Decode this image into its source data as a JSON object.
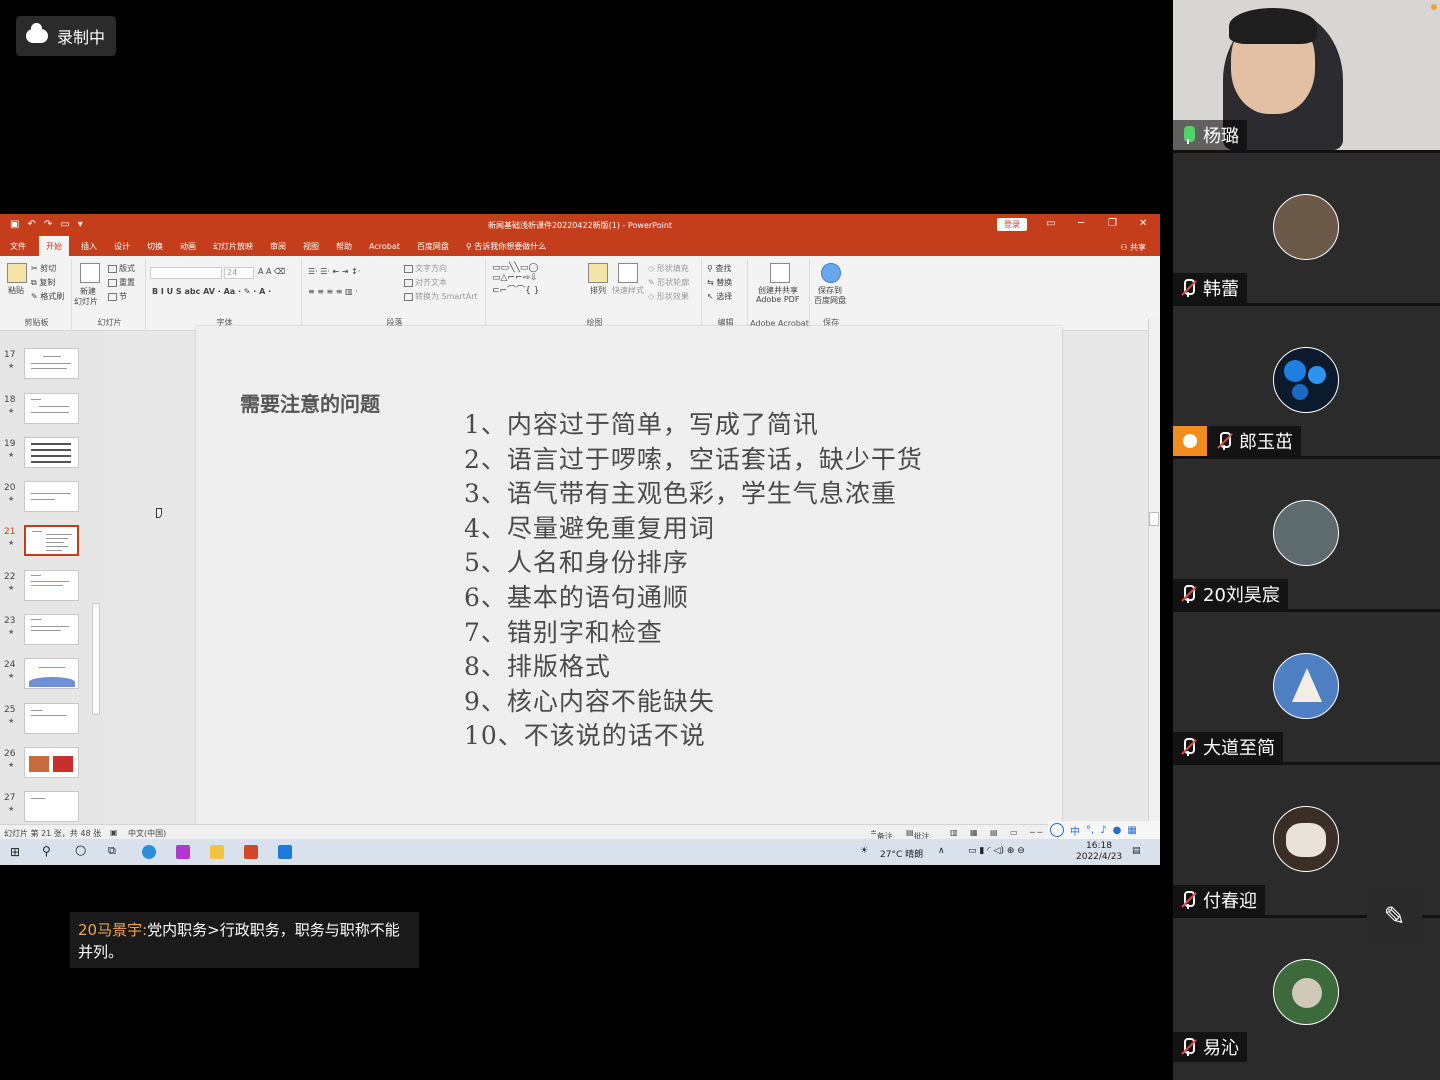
{
  "recording": {
    "label": "录制中"
  },
  "ppt": {
    "window_title": "新闻基础浅析课件20220422新版(1)  -  PowerPoint",
    "login_label": "登录",
    "share_label": "共享",
    "menu": [
      "文件",
      "开始",
      "插入",
      "设计",
      "切换",
      "动画",
      "幻灯片放映",
      "审阅",
      "视图",
      "帮助",
      "Acrobat",
      "百度网盘"
    ],
    "active_menu": "开始",
    "tell_me": "告诉我你想要做什么",
    "ribbon": {
      "clipboard": {
        "label": "剪贴板",
        "paste": "粘贴",
        "cut": "剪切",
        "copy": "复制",
        "format_painter": "格式刷"
      },
      "slides": {
        "label": "幻灯片",
        "new_slide": "新建",
        "new_slide2": "幻灯片",
        "layout": "版式",
        "reset": "重置",
        "section": "节"
      },
      "font": {
        "label": "字体",
        "size": "24"
      },
      "paragraph": {
        "label": "段落",
        "text_direction": "文字方向",
        "align_text": "对齐文本",
        "smartart": "转换为 SmartArt"
      },
      "drawing": {
        "label": "绘图",
        "arrange": "排列",
        "quick_styles": "快速样式",
        "fill": "形状填充",
        "outline": "形状轮廓",
        "effects": "形状效果"
      },
      "editing": {
        "label": "编辑",
        "find": "查找",
        "replace": "替换",
        "select": "选择"
      },
      "acrobat": {
        "label": "Adobe Acrobat",
        "create_share": "创建并共享",
        "create_share2": "Adobe PDF"
      },
      "save": {
        "label": "保存",
        "save_to": "保存到",
        "baidu": "百度网盘"
      }
    },
    "thumbnails": [
      "17",
      "18",
      "19",
      "20",
      "21",
      "22",
      "23",
      "24",
      "25",
      "26",
      "27"
    ],
    "active_thumbnail": "21",
    "slide": {
      "title": "需要注意的问题",
      "items": [
        "1、内容过于简单，写成了简讯",
        "2、语言过于啰嗦，空话套话，缺少干货",
        "3、语气带有主观色彩，学生气息浓重",
        "4、尽量避免重复用词",
        "5、人名和身份排序",
        "6、基本的语句通顺",
        "7、错别字和检查",
        "8、排版格式",
        "9、核心内容不能缺失",
        "10、不该说的话不说"
      ]
    },
    "status": {
      "slide_info": "幻灯片 第 21 张，共 48 张",
      "language": "中文(中国)",
      "notes": "备注",
      "comments": "批注"
    }
  },
  "taskbar": {
    "weather": "27°C  晴朗",
    "time": "16:18",
    "date": "2022/4/23",
    "ime": "中"
  },
  "chat": {
    "sender": "20马景宇:",
    "message": "党内职务>行政职务，职务与职称不能并列。"
  },
  "participants": [
    {
      "name": "杨璐",
      "mic": "live",
      "video": true
    },
    {
      "name": "韩蕾",
      "mic": "muted"
    },
    {
      "name": "郎玉茁",
      "mic": "muted",
      "host": true
    },
    {
      "name": "20刘昊宸",
      "mic": "muted"
    },
    {
      "name": "大道至简",
      "mic": "muted"
    },
    {
      "name": "付春迎",
      "mic": "muted"
    },
    {
      "name": "易沁",
      "mic": "muted"
    }
  ],
  "colors": {
    "ppt_accent": "#c43e1c",
    "chat_sender": "#f0a354",
    "host_badge": "#f18c1f"
  }
}
